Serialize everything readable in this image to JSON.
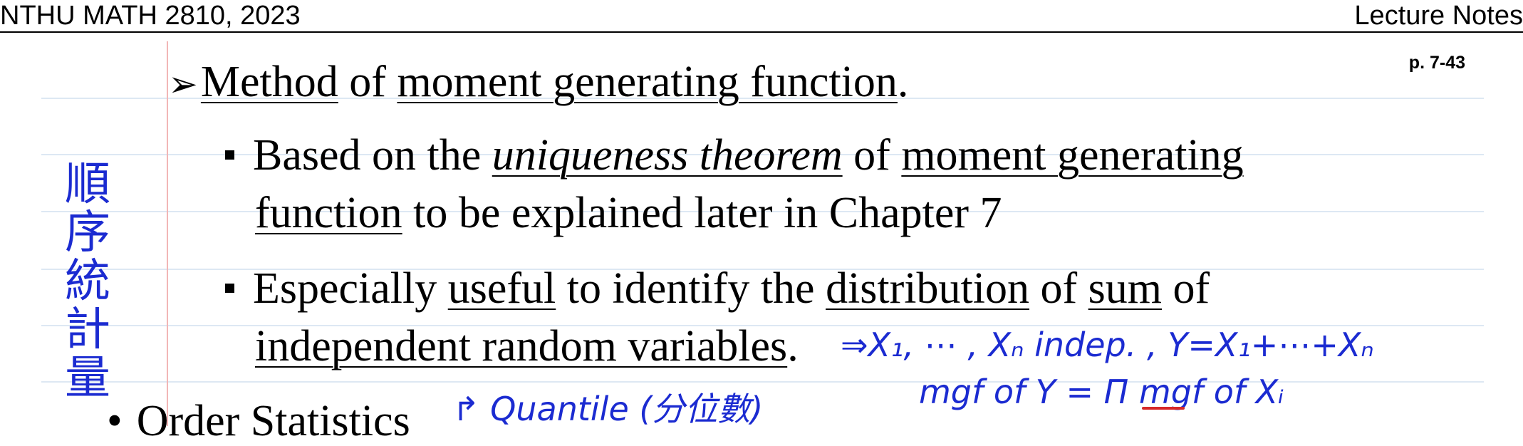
{
  "header": {
    "left": "NTHU MATH 2810, 2023",
    "right": "Lecture Notes"
  },
  "page_number": "p. 7-43",
  "heading": {
    "prefix": "Method",
    "mid": " of ",
    "rest": "moment generating function",
    "end": "."
  },
  "bullet1": {
    "a": "Based on the ",
    "b": "uniqueness theorem",
    "c": " of ",
    "d": "moment generating",
    "e": "function",
    "f": " to be explained later in Chapter 7"
  },
  "bullet2": {
    "a": "Especially ",
    "b": "useful",
    "c": " to identify the ",
    "d": "distribution",
    "e": " of ",
    "f": "sum",
    "g": " of",
    "h": "independent random variables",
    "i": "."
  },
  "partial_line": {
    "text": "Order Statistics"
  },
  "annotations": {
    "vertical": [
      "順",
      "序",
      "統",
      "計",
      "量"
    ],
    "indep": "⇒X₁, ⋯ , Xₙ indep. , Y=X₁+⋯+Xₙ",
    "mgf": "mgf of Y = Π mgf of Xᵢ",
    "quantile": "↱ Quantile (分位數)"
  }
}
